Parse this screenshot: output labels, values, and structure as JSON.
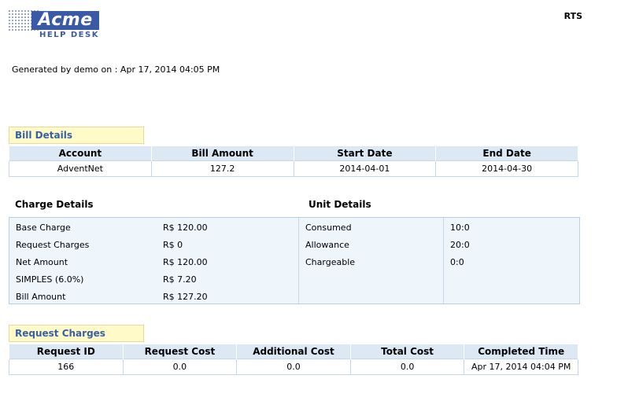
{
  "logo": {
    "name": "Acme",
    "tagline": "HELP DESK"
  },
  "header": {
    "right_label": "RTS"
  },
  "generated_text": "Generated by demo  on : Apr 17, 2014 04:05 PM",
  "bill_details": {
    "title": "Bill Details",
    "columns": [
      "Account",
      "Bill Amount",
      "Start Date",
      "End Date"
    ],
    "row": [
      "AdventNet",
      "127.2",
      "2014-04-01",
      "2014-04-30"
    ]
  },
  "charge_details": {
    "title": "Charge Details",
    "items": [
      {
        "label": "Base Charge",
        "value": "R$ 120.00"
      },
      {
        "label": "Request Charges",
        "value": "R$ 0"
      },
      {
        "label": "Net Amount",
        "value": "R$ 120.00"
      },
      {
        "label": "SIMPLES (6.0%)",
        "value": "R$ 7.20"
      },
      {
        "label": "Bill Amount",
        "value": "R$ 127.20"
      }
    ]
  },
  "unit_details": {
    "title": "Unit Details",
    "items": [
      {
        "label": "Consumed",
        "value": "10:0"
      },
      {
        "label": "Allowance",
        "value": "20:0"
      },
      {
        "label": "Chargeable",
        "value": "0:0"
      }
    ]
  },
  "request_charges": {
    "title": "Request Charges",
    "columns": [
      "Request ID",
      "Request Cost",
      "Additional Cost",
      "Total Cost",
      "Completed Time"
    ],
    "row": [
      "166",
      "0.0",
      "0.0",
      "0.0",
      "Apr 17, 2014 04:04 PM"
    ]
  },
  "colors": {
    "brand_blue": "#3a5aa6",
    "section_label_bg": "#fffac8",
    "table_header_bg": "#dde8f5",
    "panel_bg": "#eef5fb"
  }
}
